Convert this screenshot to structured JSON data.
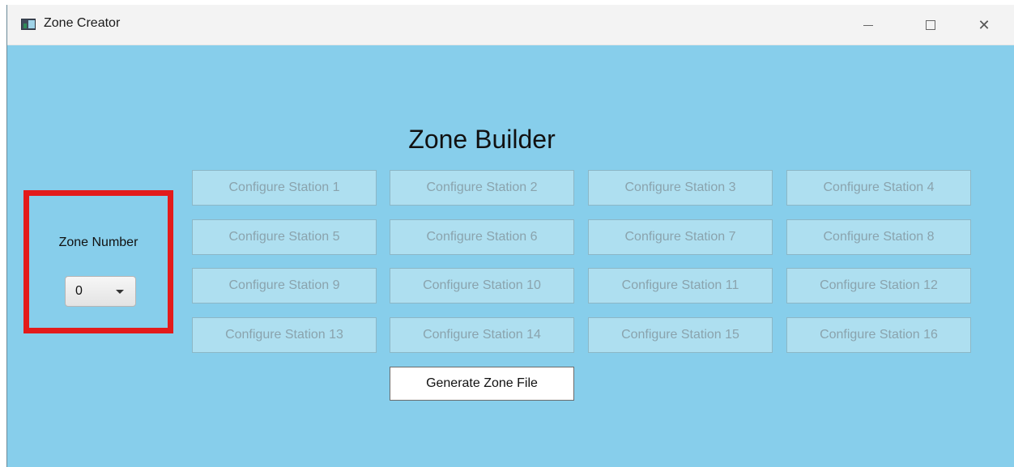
{
  "window": {
    "title": "Zone Creator",
    "icon": "app-icon",
    "controls": [
      "minimize-icon",
      "maximize-icon",
      "close-icon"
    ]
  },
  "main": {
    "heading": "Zone Builder",
    "zone": {
      "label": "Zone Number",
      "selected_value": "0",
      "highlight_color": "#e31b1b"
    },
    "stations": [
      "Configure Station 1",
      "Configure Station 2",
      "Configure Station 3",
      "Configure Station 4",
      "Configure Station 5",
      "Configure Station 6",
      "Configure Station 7",
      "Configure Station 8",
      "Configure Station 9",
      "Configure Station 10",
      "Configure Station 11",
      "Configure Station 12",
      "Configure Station 13",
      "Configure Station 14",
      "Configure Station 15",
      "Configure Station 16"
    ],
    "stations_state": "disabled",
    "generate_label": "Generate Zone File"
  },
  "colors": {
    "background": "#87ceeb",
    "station_button": "#aedff0",
    "station_text": "#8aa3ad"
  }
}
